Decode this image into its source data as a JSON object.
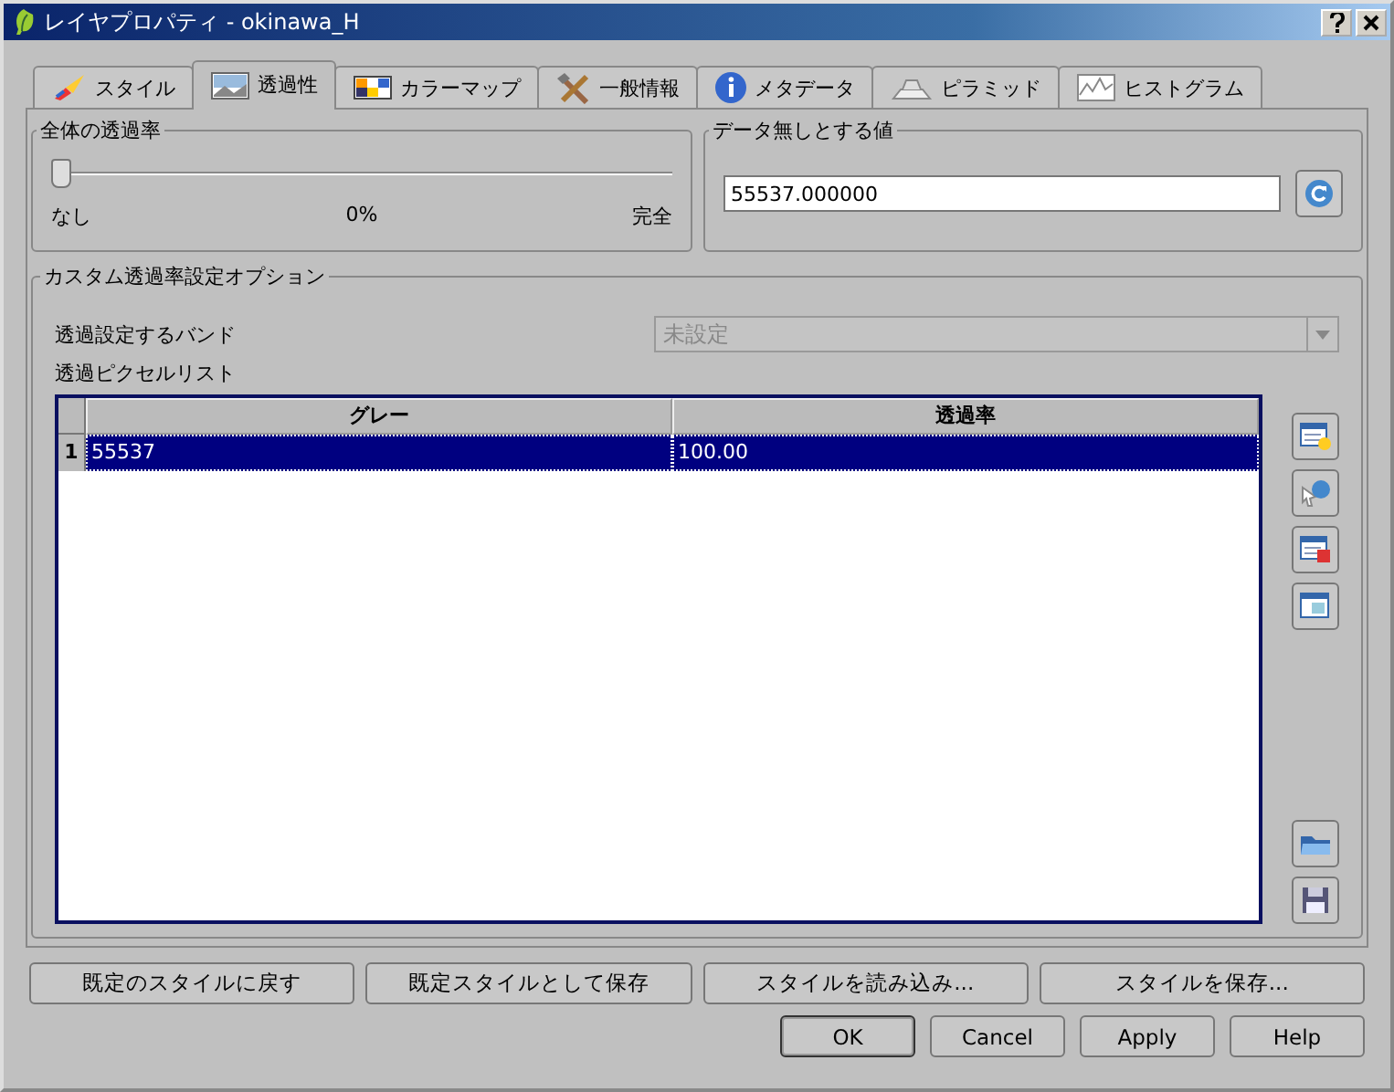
{
  "window": {
    "title": "レイヤプロパティ - okinawa_H"
  },
  "tabs": [
    {
      "label": "スタイル",
      "selected": false
    },
    {
      "label": "透過性",
      "selected": true
    },
    {
      "label": "カラーマップ",
      "selected": false
    },
    {
      "label": "一般情報",
      "selected": false
    },
    {
      "label": "メタデータ",
      "selected": false
    },
    {
      "label": "ピラミッド",
      "selected": false
    },
    {
      "label": "ヒストグラム",
      "selected": false
    }
  ],
  "global_transparency": {
    "title": "全体の透過率",
    "level": 0,
    "min_label": "なし",
    "reading": "0%",
    "max_label": "完全"
  },
  "no_data": {
    "title": "データ無しとする値",
    "value": "55537.000000"
  },
  "custom": {
    "title": "カスタム透過率設定オプション",
    "band_label": "透過設定するバンド",
    "band_value": "未設定",
    "band_disabled": true,
    "list_label": "透過ピクセルリスト",
    "table": {
      "columns": [
        "グレー",
        "透過率"
      ],
      "rows": [
        {
          "number": "1",
          "cells": [
            "55537",
            "100.00"
          ],
          "selected": true
        }
      ]
    }
  },
  "style_buttons": [
    "既定のスタイルに戻す",
    "既定スタイルとして保存",
    "スタイルを読み込み...",
    "スタイルを保存..."
  ],
  "dialog_buttons": [
    {
      "label": "OK",
      "default": true
    },
    {
      "label": "Cancel",
      "default": false
    },
    {
      "label": "Apply",
      "default": false
    },
    {
      "label": "Help",
      "default": false
    }
  ]
}
